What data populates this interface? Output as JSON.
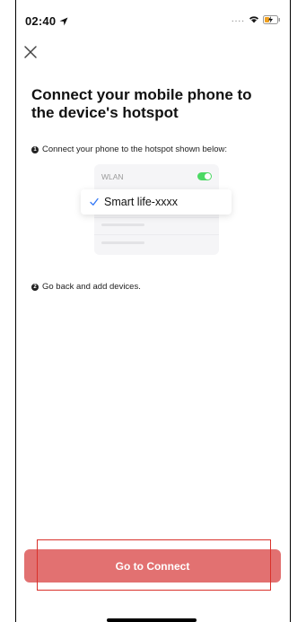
{
  "status_bar": {
    "time": "02:40",
    "signal_text": "....",
    "icons": [
      "location-arrow-icon",
      "wifi-icon",
      "battery-charging-icon"
    ]
  },
  "header": {
    "close_icon": "close-icon"
  },
  "main": {
    "title": "Connect your mobile phone to the device's hotspot",
    "step1": {
      "number": "1",
      "text": "Connect your phone to the hotspot shown below:"
    },
    "illustration": {
      "wlan_label": "WLAN",
      "wlan_toggle": "on",
      "network_name": "Smart life-xxxx",
      "check_icon": "checkmark-icon"
    },
    "step2": {
      "number": "2",
      "text": "Go back and add devices."
    }
  },
  "footer": {
    "button_label": "Go to Connect"
  },
  "colors": {
    "button": "#e27171",
    "highlight": "#d9312b",
    "toggle": "#4cd964",
    "checkmark": "#3478f6"
  }
}
